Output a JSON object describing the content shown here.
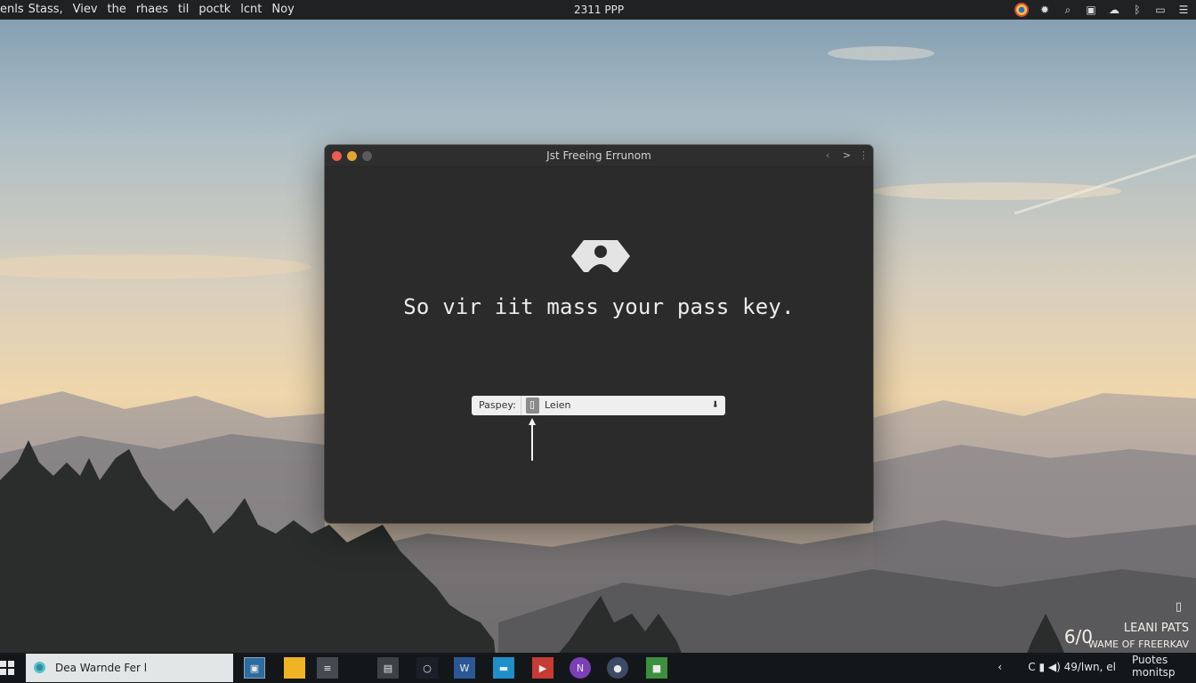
{
  "menubar": {
    "items": [
      "enls",
      "Stass,",
      "Viev",
      "the",
      "rhaes",
      "til",
      "poctk",
      "lcnt",
      "Noy"
    ],
    "clock": "2311 PPP",
    "tray_icons": [
      "browser-icon",
      "gear-icon",
      "search-icon",
      "window-icon",
      "cloud-icon",
      "bluetooth-icon",
      "display-icon",
      "list-icon"
    ]
  },
  "dialog": {
    "title": "Jst Freeing Errunom",
    "nav": {
      "back": "‹",
      "forward": ">",
      "more": "⋮"
    },
    "prompt": "So vir iit mass your pass key.",
    "passkey": {
      "label": "Paspey:",
      "value": "Leien",
      "dropdown": "⬇"
    }
  },
  "desktop_note": {
    "line1": "LEANI PATS",
    "big": "6/0",
    "line2": "WAME OF FREERKAV"
  },
  "taskbar": {
    "search_text": "Dea Warnde Fer l",
    "apps": [
      {
        "name": "file-manager-icon",
        "glyph": "▣",
        "color": "#2c6c9e"
      },
      {
        "name": "chrome-icon",
        "glyph": "",
        "color": "#f0b323"
      },
      {
        "name": "task-view-icon",
        "glyph": "≡",
        "color": "#444a4f"
      },
      {
        "name": "notes-icon",
        "glyph": "▤",
        "color": "#3c4144"
      },
      {
        "name": "cortana-icon",
        "glyph": "○",
        "color": "#1b1f2a"
      },
      {
        "name": "word-icon",
        "glyph": "W",
        "color": "#2b5797"
      },
      {
        "name": "explorer-icon",
        "glyph": "▬",
        "color": "#1f8fc9"
      },
      {
        "name": "media-icon",
        "glyph": "▶",
        "color": "#c63b34"
      },
      {
        "name": "onenote-icon",
        "glyph": "N",
        "color": "#7b3fb7"
      },
      {
        "name": "github-icon",
        "glyph": "●",
        "color": "#3d4a66"
      },
      {
        "name": "store-icon",
        "glyph": "■",
        "color": "#3b8f3e"
      }
    ],
    "tray_status": "C ▮ ◀) 49/lwn, el",
    "notif": "Puotes monitsp"
  }
}
